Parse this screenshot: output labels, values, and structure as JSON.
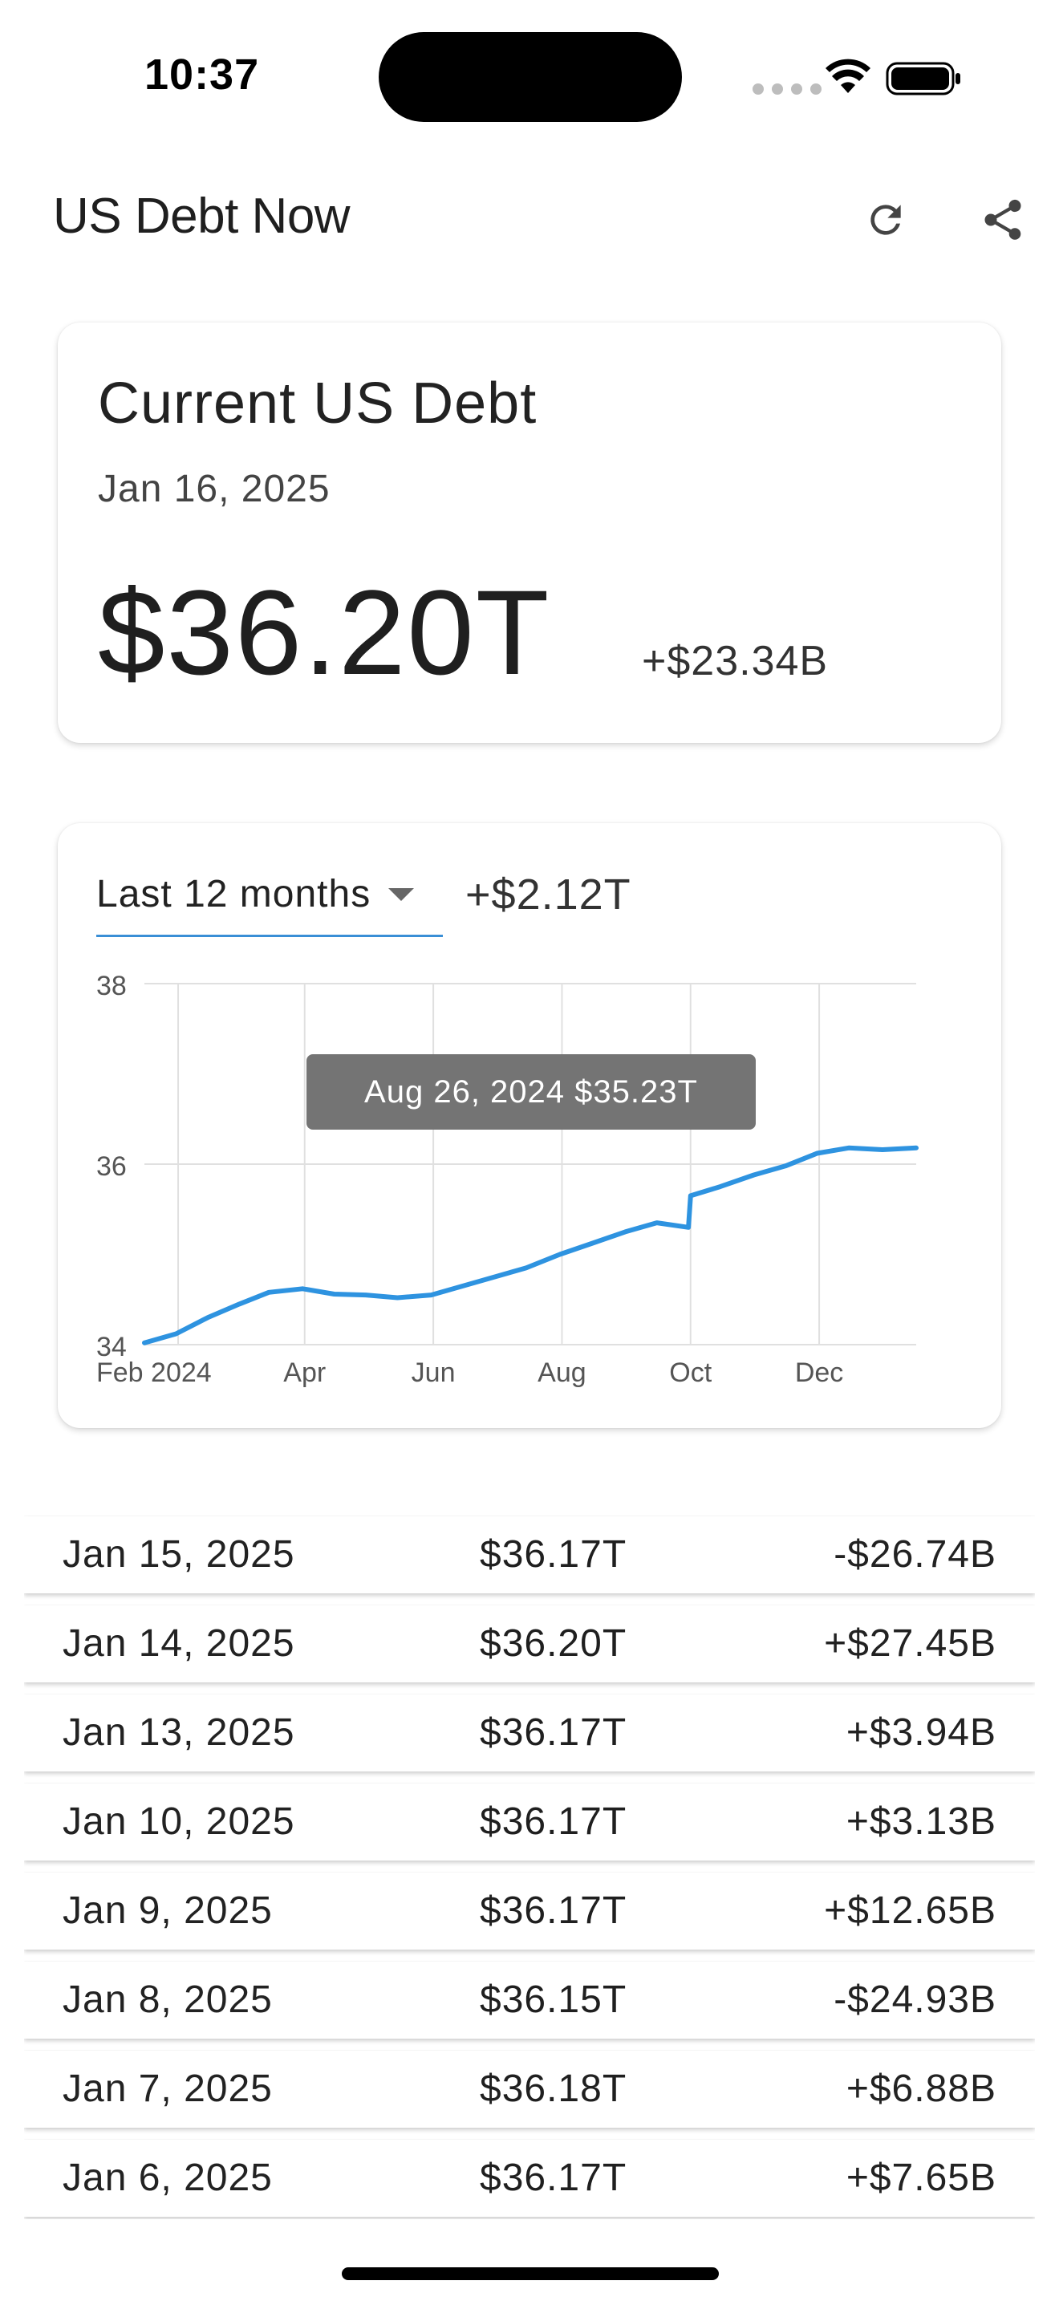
{
  "status_bar": {
    "time": "10:37"
  },
  "app_bar": {
    "title": "US Debt Now",
    "refresh_icon": "refresh-icon",
    "share_icon": "share-icon"
  },
  "current_debt": {
    "title": "Current US Debt",
    "date": "Jan 16, 2025",
    "amount": "$36.20T",
    "change": "+$23.34B"
  },
  "chart_panel": {
    "range_label": "Last 12 months",
    "range_change": "+$2.12T"
  },
  "chart_data": {
    "type": "line",
    "ylim": [
      34,
      38
    ],
    "y_ticks": [
      "34",
      "36",
      "38"
    ],
    "x_tick_labels": [
      "Feb 2024",
      "Apr",
      "Jun",
      "Aug",
      "Oct",
      "Dec"
    ],
    "grid": true,
    "tooltip": "Aug 26, 2024 $35.23T",
    "color": "#2e93e0",
    "series": [
      {
        "x": [
          "2024-01-16",
          "2024-01-31",
          "2024-02-15",
          "2024-03-01",
          "2024-03-15",
          "2024-03-31",
          "2024-04-15",
          "2024-04-30",
          "2024-05-15",
          "2024-05-31",
          "2024-06-15",
          "2024-06-30",
          "2024-07-15",
          "2024-07-31",
          "2024-08-15",
          "2024-08-31",
          "2024-09-15",
          "2024-09-30",
          "2024-10-01",
          "2024-10-15",
          "2024-10-31",
          "2024-11-15",
          "2024-11-30",
          "2024-12-15",
          "2024-12-31",
          "2025-01-16"
        ],
        "y": [
          34.02,
          34.12,
          34.3,
          34.45,
          34.58,
          34.62,
          34.56,
          34.55,
          34.52,
          34.55,
          34.65,
          34.75,
          34.85,
          35.0,
          35.12,
          35.25,
          35.35,
          35.3,
          35.65,
          35.75,
          35.88,
          35.98,
          36.12,
          36.18,
          36.16,
          36.18
        ]
      }
    ]
  },
  "history": [
    {
      "date": "Jan 15, 2025",
      "value": "$36.17T",
      "change": "-$26.74B"
    },
    {
      "date": "Jan 14, 2025",
      "value": "$36.20T",
      "change": "+$27.45B"
    },
    {
      "date": "Jan 13, 2025",
      "value": "$36.17T",
      "change": "+$3.94B"
    },
    {
      "date": "Jan 10, 2025",
      "value": "$36.17T",
      "change": "+$3.13B"
    },
    {
      "date": "Jan 9, 2025",
      "value": "$36.17T",
      "change": "+$12.65B"
    },
    {
      "date": "Jan 8, 2025",
      "value": "$36.15T",
      "change": "-$24.93B"
    },
    {
      "date": "Jan 7, 2025",
      "value": "$36.18T",
      "change": "+$6.88B"
    },
    {
      "date": "Jan 6, 2025",
      "value": "$36.17T",
      "change": "+$7.65B"
    }
  ]
}
